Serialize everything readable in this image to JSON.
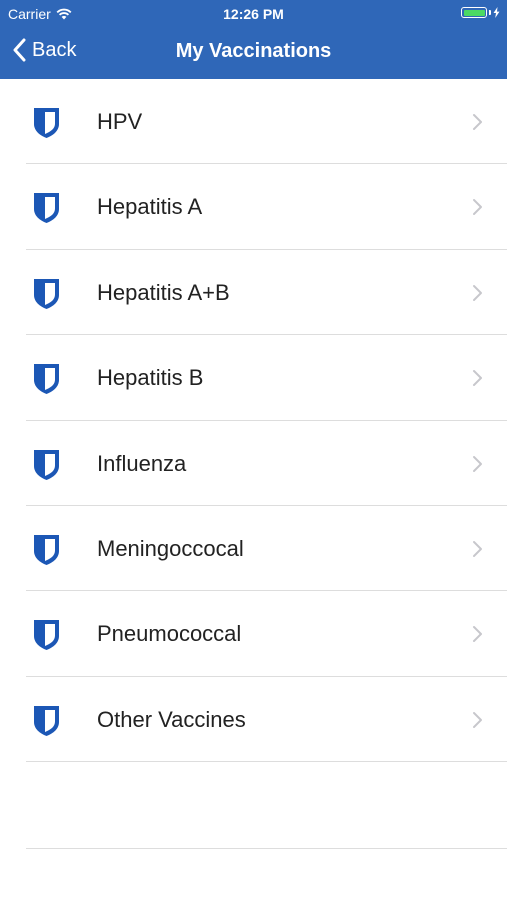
{
  "status_bar": {
    "carrier": "Carrier",
    "time": "12:26 PM",
    "battery_color": "#4cd964"
  },
  "nav": {
    "back_label": "Back",
    "title": "My Vaccinations",
    "background": "#2f67b8"
  },
  "vaccines": [
    {
      "label": "HPV",
      "icon": "shield-icon"
    },
    {
      "label": "Hepatitis A",
      "icon": "shield-icon"
    },
    {
      "label": "Hepatitis A+B",
      "icon": "shield-icon"
    },
    {
      "label": "Hepatitis B",
      "icon": "shield-icon"
    },
    {
      "label": "Influenza",
      "icon": "shield-icon"
    },
    {
      "label": "Meningoccocal",
      "icon": "shield-icon"
    },
    {
      "label": "Pneumococcal",
      "icon": "shield-icon"
    },
    {
      "label": "Other Vaccines",
      "icon": "shield-icon"
    }
  ],
  "colors": {
    "shield": "#1c57b5",
    "chevron": "#c7c7cc"
  }
}
